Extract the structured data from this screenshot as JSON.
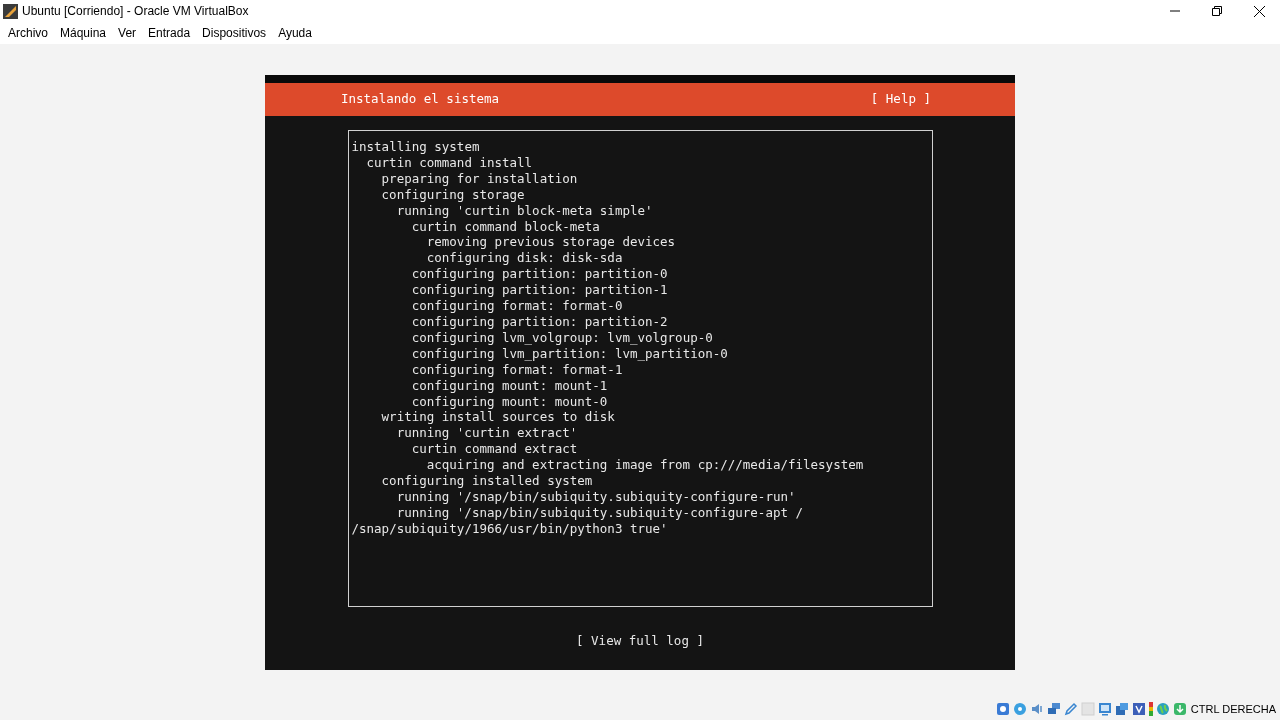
{
  "window": {
    "title": "Ubuntu [Corriendo] - Oracle VM VirtualBox"
  },
  "menu": [
    "Archivo",
    "Máquina",
    "Ver",
    "Entrada",
    "Dispositivos",
    "Ayuda"
  ],
  "installer": {
    "title": "Instalando el sistema",
    "help_button": "[ Help ]",
    "log": [
      {
        "text": "installing system",
        "children": [
          {
            "text": "curtin command install",
            "children": [
              {
                "text": "preparing for installation"
              },
              {
                "text": "configuring storage",
                "children": [
                  {
                    "text": "running 'curtin block-meta simple'",
                    "children": [
                      {
                        "text": "curtin command block-meta",
                        "children": [
                          {
                            "text": "removing previous storage devices"
                          },
                          {
                            "text": "configuring disk: disk-sda"
                          }
                        ]
                      },
                      {
                        "text": "configuring partition: partition-0"
                      },
                      {
                        "text": "configuring partition: partition-1"
                      },
                      {
                        "text": "configuring format: format-0"
                      },
                      {
                        "text": "configuring partition: partition-2"
                      },
                      {
                        "text": "configuring lvm_volgroup: lvm_volgroup-0"
                      },
                      {
                        "text": "configuring lvm_partition: lvm_partition-0"
                      },
                      {
                        "text": "configuring format: format-1"
                      },
                      {
                        "text": "configuring mount: mount-1"
                      },
                      {
                        "text": "configuring mount: mount-0"
                      }
                    ]
                  }
                ]
              },
              {
                "text": "writing install sources to disk",
                "children": [
                  {
                    "text": "running 'curtin extract'",
                    "children": [
                      {
                        "text": "curtin command extract",
                        "children": [
                          {
                            "text": "acquiring and extracting image from cp:///media/filesystem"
                          }
                        ]
                      }
                    ]
                  }
                ]
              },
              {
                "text": "configuring installed system",
                "children": [
                  {
                    "text": "running '/snap/bin/subiquity.subiquity-configure-run'"
                  },
                  {
                    "text": "running '/snap/bin/subiquity.subiquity-configure-apt / /snap/subiquity/1966/usr/bin/python3 true'"
                  }
                ]
              }
            ]
          }
        ]
      }
    ],
    "view_log_button": "[ View full log ]"
  },
  "status_bar": {
    "host_key": "CTRL DERECHA"
  }
}
